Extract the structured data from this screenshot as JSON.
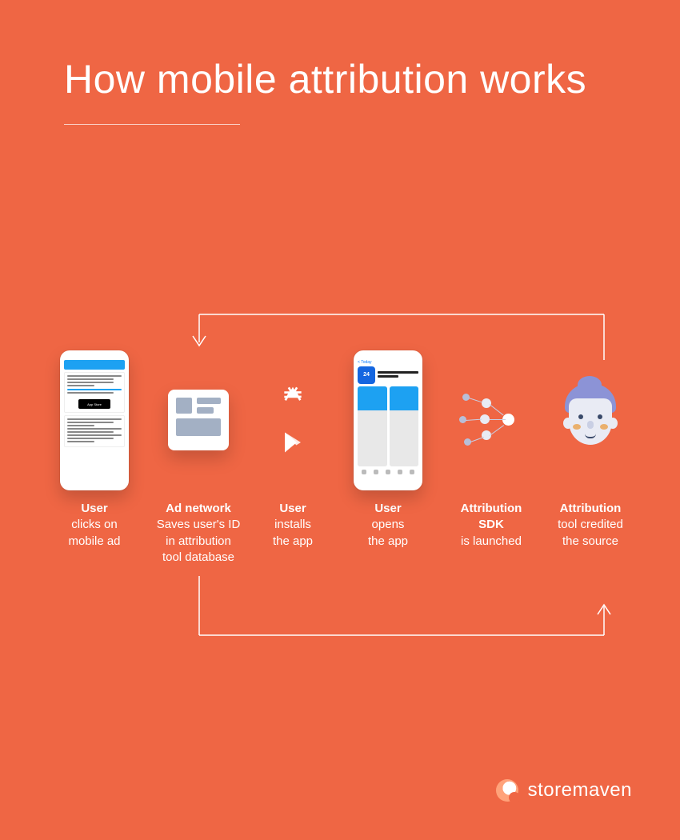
{
  "title": "How mobile attribution works",
  "steps": [
    {
      "bold": "User",
      "rest": "clicks on\nmobile ad"
    },
    {
      "bold": "Ad network",
      "rest": "Saves user's ID\nin attribution\ntool database"
    },
    {
      "bold": "User",
      "rest": "installs\nthe app"
    },
    {
      "bold": "User",
      "rest": "opens\nthe app"
    },
    {
      "bold": "Attribution\nSDK",
      "rest": "is launched"
    },
    {
      "bold": "Attribution",
      "rest": "tool credited\nthe source"
    }
  ],
  "brand": "storemaven",
  "icon_labels": {
    "phone1": "mobile ad feed",
    "adcard": "ad network card",
    "apple_store": "App Store icon",
    "google_play": "Google Play icon",
    "phone2": "app store listing",
    "sdk": "attribution sdk network",
    "avatar": "user avatar"
  }
}
